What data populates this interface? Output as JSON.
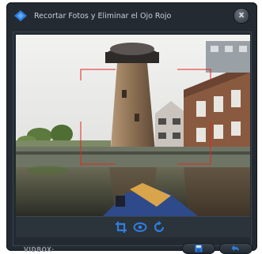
{
  "window": {
    "title": "Recortar Fotos y Eliminar el Ojo Rojo",
    "close_label": "x"
  },
  "footer": {
    "brand": "VIDBOX·"
  },
  "icons": {
    "logo": "vidbox-logo-icon",
    "crop": "crop-icon",
    "red_eye": "eye-icon",
    "rotate": "rotate-icon",
    "save": "save-icon",
    "back": "back-icon"
  },
  "colors": {
    "window_bg": "#232a31",
    "accent_blue": "#2f7ee0",
    "crop_frame": "#e0261f"
  }
}
